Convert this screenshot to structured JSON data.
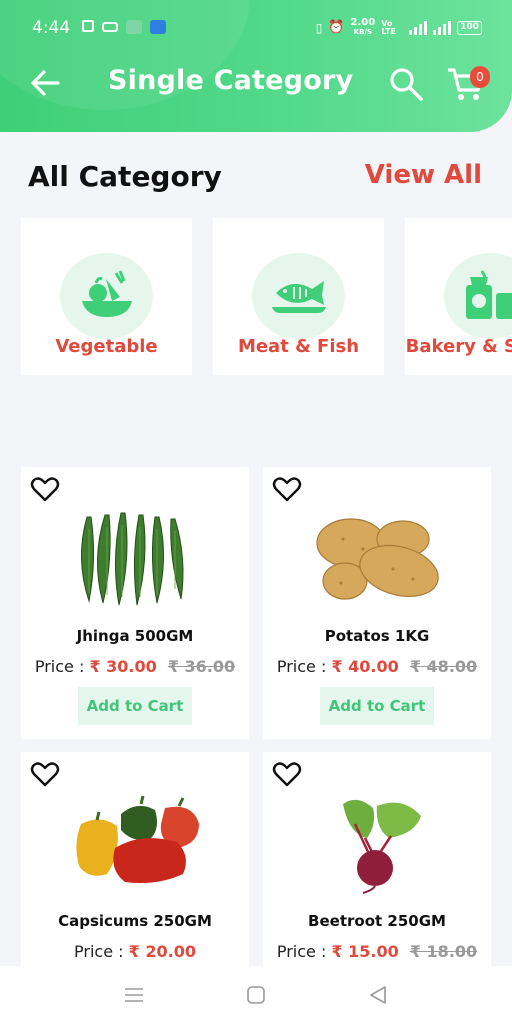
{
  "status_bar": {
    "time": "4:44",
    "speed": "2.00",
    "speed_unit": "KB/S",
    "network": "Vo LTE",
    "battery": "100"
  },
  "header": {
    "title": "Single Category",
    "cart_count": "0"
  },
  "section": {
    "title": "All Category",
    "view_all": "View All"
  },
  "categories": [
    {
      "label": "Vegetable",
      "icon": "vegetable-icon"
    },
    {
      "label": "Meat & Fish",
      "icon": "fish-icon"
    },
    {
      "label": "Bakery & Snacks",
      "icon": "bakery-icon"
    }
  ],
  "products": [
    {
      "name": "Jhinga 500GM",
      "price_label": "Price :",
      "price": "₹ 30.00",
      "old_price": "₹ 36.00",
      "button": "Add to Cart"
    },
    {
      "name": "Potatos 1KG",
      "price_label": "Price :",
      "price": "₹ 40.00",
      "old_price": "₹ 48.00",
      "button": "Add to Cart"
    },
    {
      "name": "Capsicums 250GM",
      "price_label": "Price :",
      "price": "₹ 20.00",
      "old_price": "",
      "button": ""
    },
    {
      "name": "Beetroot 250GM",
      "price_label": "Price :",
      "price": "₹ 15.00",
      "old_price": "₹ 18.00",
      "button": ""
    }
  ],
  "colors": {
    "accent": "#3fcf78",
    "brand_red": "#e04a3c",
    "chip_bg": "#e5f6ec"
  }
}
